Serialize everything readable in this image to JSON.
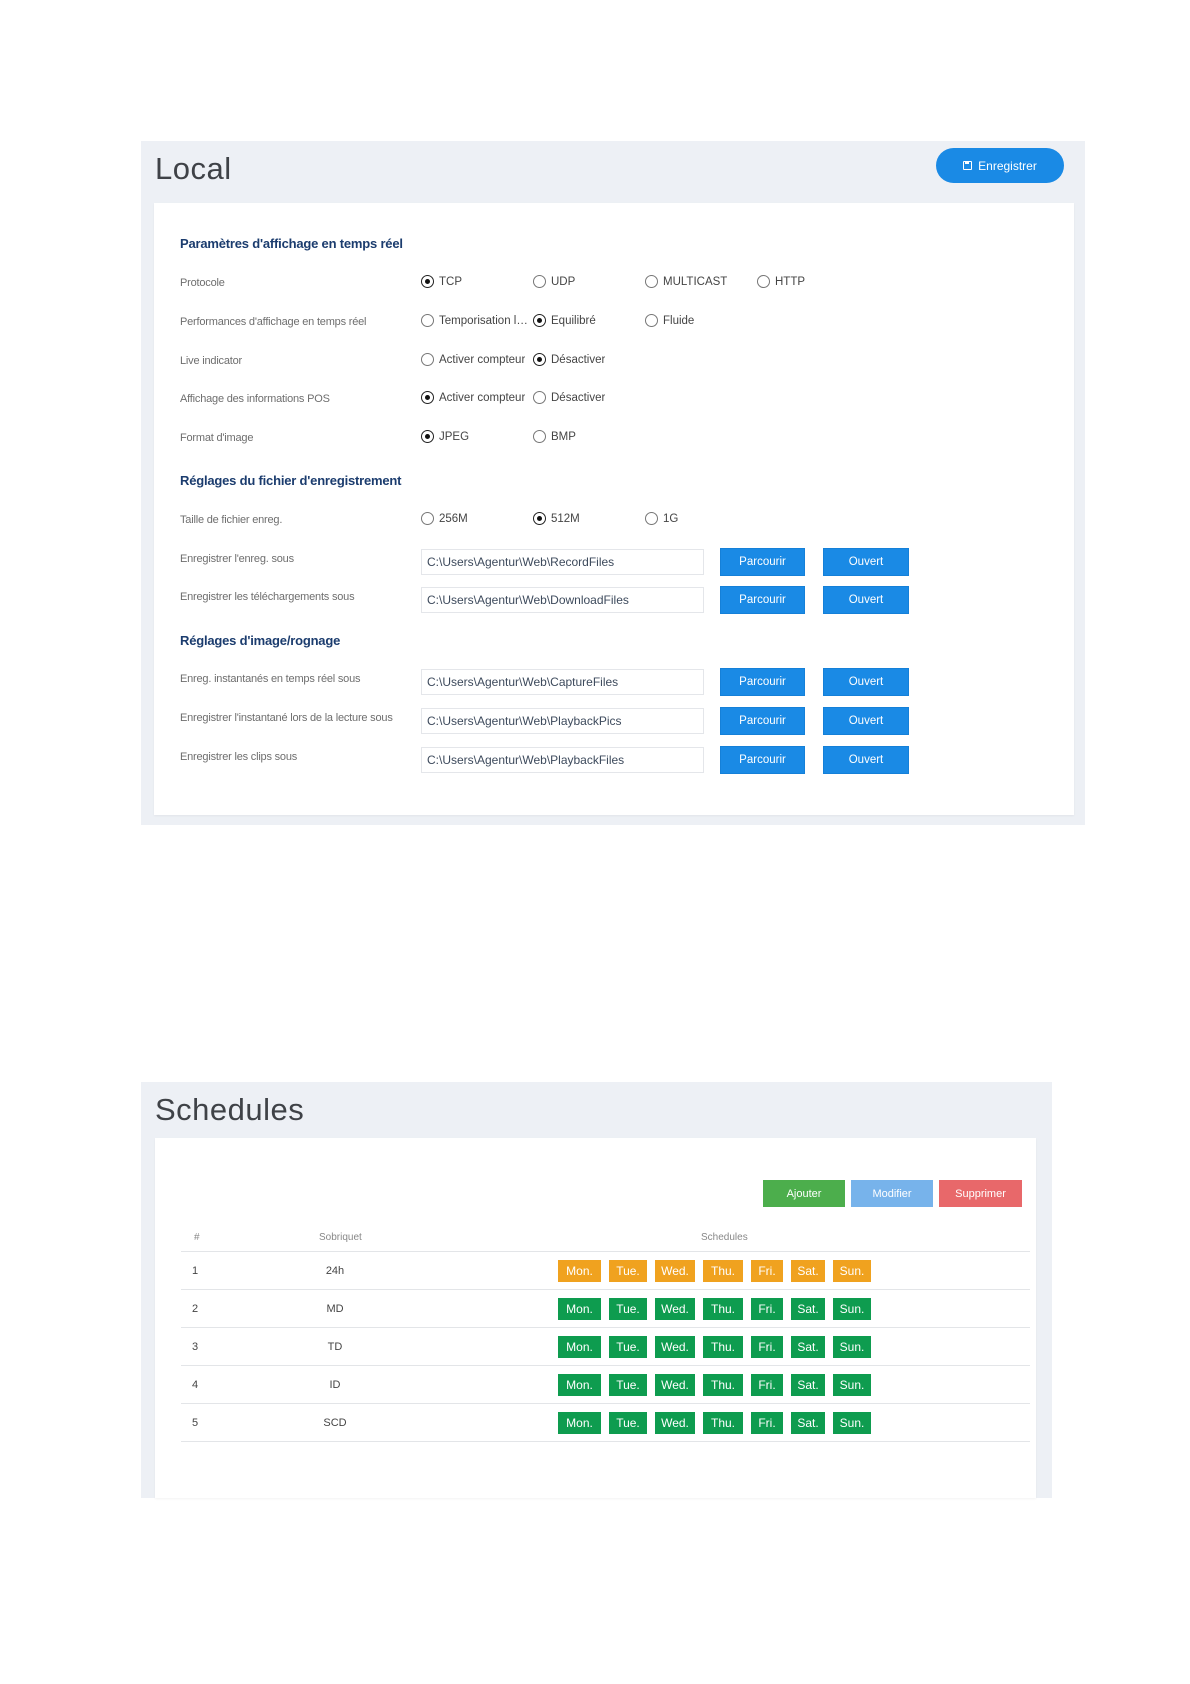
{
  "local": {
    "title": "Local",
    "save_label": "Enregistrer",
    "section_display": "Paramètres d'affichage en temps réel",
    "protocol": {
      "label": "Protocole",
      "options": [
        "TCP",
        "UDP",
        "MULTICAST",
        "HTTP"
      ],
      "selected": "TCP"
    },
    "performance": {
      "label": "Performances d'affichage en temps réel",
      "options": [
        "Temporisation la...",
        "Équilibré",
        "Fluide"
      ],
      "selected": "Équilibré"
    },
    "live_indicator": {
      "label": "Live indicator",
      "options": [
        "Activer compteur",
        "Désactiver"
      ],
      "selected": "Désactiver"
    },
    "pos_info": {
      "label": "Affichage des informations POS",
      "options": [
        "Activer compteur",
        "Désactiver"
      ],
      "selected": "Activer compteur"
    },
    "image_format": {
      "label": "Format d'image",
      "options": [
        "JPEG",
        "BMP"
      ],
      "selected": "JPEG"
    },
    "section_record": "Réglages du fichier d'enregistrement",
    "file_size": {
      "label": "Taille de fichier enreg.",
      "options": [
        "256M",
        "512M",
        "1G"
      ],
      "selected": "512M"
    },
    "browse_label": "Parcourir",
    "open_label": "Ouvert",
    "record_path": {
      "label": "Enregistrer l'enreg. sous",
      "value": "C:\\Users\\Agentur\\Web\\RecordFiles"
    },
    "download_path": {
      "label": "Enregistrer les téléchargements sous",
      "value": "C:\\Users\\Agentur\\Web\\DownloadFiles"
    },
    "section_image": "Réglages d'image/rognage",
    "capture_path": {
      "label": "Enreg. instantanés en temps réel sous",
      "value": "C:\\Users\\Agentur\\Web\\CaptureFiles"
    },
    "playback_path": {
      "label": "Enregistrer l'instantané lors de la lecture sous",
      "value": "C:\\Users\\Agentur\\Web\\PlaybackPics"
    },
    "clips_path": {
      "label": "Enregistrer les clips sous",
      "value": "C:\\Users\\Agentur\\Web\\PlaybackFiles"
    }
  },
  "schedules": {
    "title": "Schedules",
    "add_label": "Ajouter",
    "edit_label": "Modifier",
    "delete_label": "Supprimer",
    "columns": [
      "#",
      "Sobriquet",
      "Schedules"
    ],
    "day_labels": [
      "Mon.",
      "Tue.",
      "Wed.",
      "Thu.",
      "Fri.",
      "Sat.",
      "Sun."
    ],
    "rows": [
      {
        "index": "1",
        "name": "24h",
        "color": "orange"
      },
      {
        "index": "2",
        "name": "MD",
        "color": "green"
      },
      {
        "index": "3",
        "name": "TD",
        "color": "green"
      },
      {
        "index": "4",
        "name": "ID",
        "color": "green"
      },
      {
        "index": "5",
        "name": "SCD",
        "color": "green"
      }
    ]
  },
  "colors": {
    "primary": "#1a8ae5",
    "heading": "#1b3c6e",
    "add": "#4cae4c",
    "edit": "#77b3eb",
    "delete": "#e8686a",
    "orange": "#f0a21f",
    "green": "#0e9c4f"
  }
}
